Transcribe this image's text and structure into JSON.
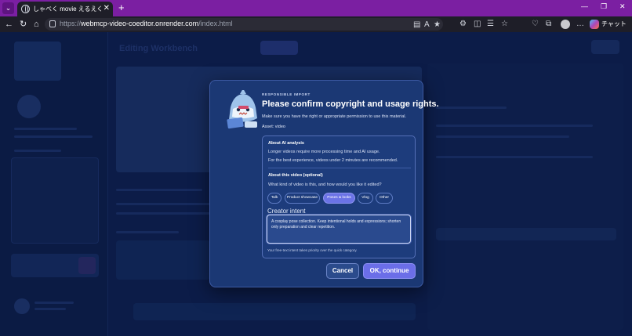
{
  "browser": {
    "tab_title": "しゃべく movie えるえくた～ — Editing",
    "url_prefix": "https://",
    "url_host": "webmcp-video-coeditor.onrender.com",
    "url_path": "/index.html",
    "chat_label": "チャット",
    "colors": {
      "tabbar": "#7b1fa2",
      "toolbar": "#1e1e28"
    }
  },
  "app": {
    "title": "Editing Workbench"
  },
  "modal": {
    "eyebrow": "RESPONSIBLE IMPORT",
    "title": "Please confirm copyright and usage rights.",
    "subtitle": "Make sure you have the right or appropriate permission to use this material.",
    "asset": "Asset: video",
    "about_ai": {
      "heading": "About AI analysis",
      "line1": "Longer videos require more processing time and AI usage.",
      "line2": "For the best experience, videos under 2 minutes are recommended."
    },
    "about_video": {
      "heading": "About this video (optional)",
      "question": "What kind of video is this, and how would you like it edited?",
      "chips": [
        "Talk",
        "Product showcase",
        "Poses & looks",
        "Vlog",
        "Other"
      ],
      "selected_chip": "Poses & looks"
    },
    "creator_intent": {
      "label": "Creator intent",
      "value": "A cosplay pose collection. Keep intentional holds and expressions; shorten only preparation and clear repetition.",
      "hint": "Your free-text intent takes priority over the quick category."
    },
    "buttons": {
      "cancel": "Cancel",
      "ok": "OK, continue"
    },
    "colors": {
      "accent": "#6b6ee8",
      "panel": "#1b3874"
    }
  }
}
